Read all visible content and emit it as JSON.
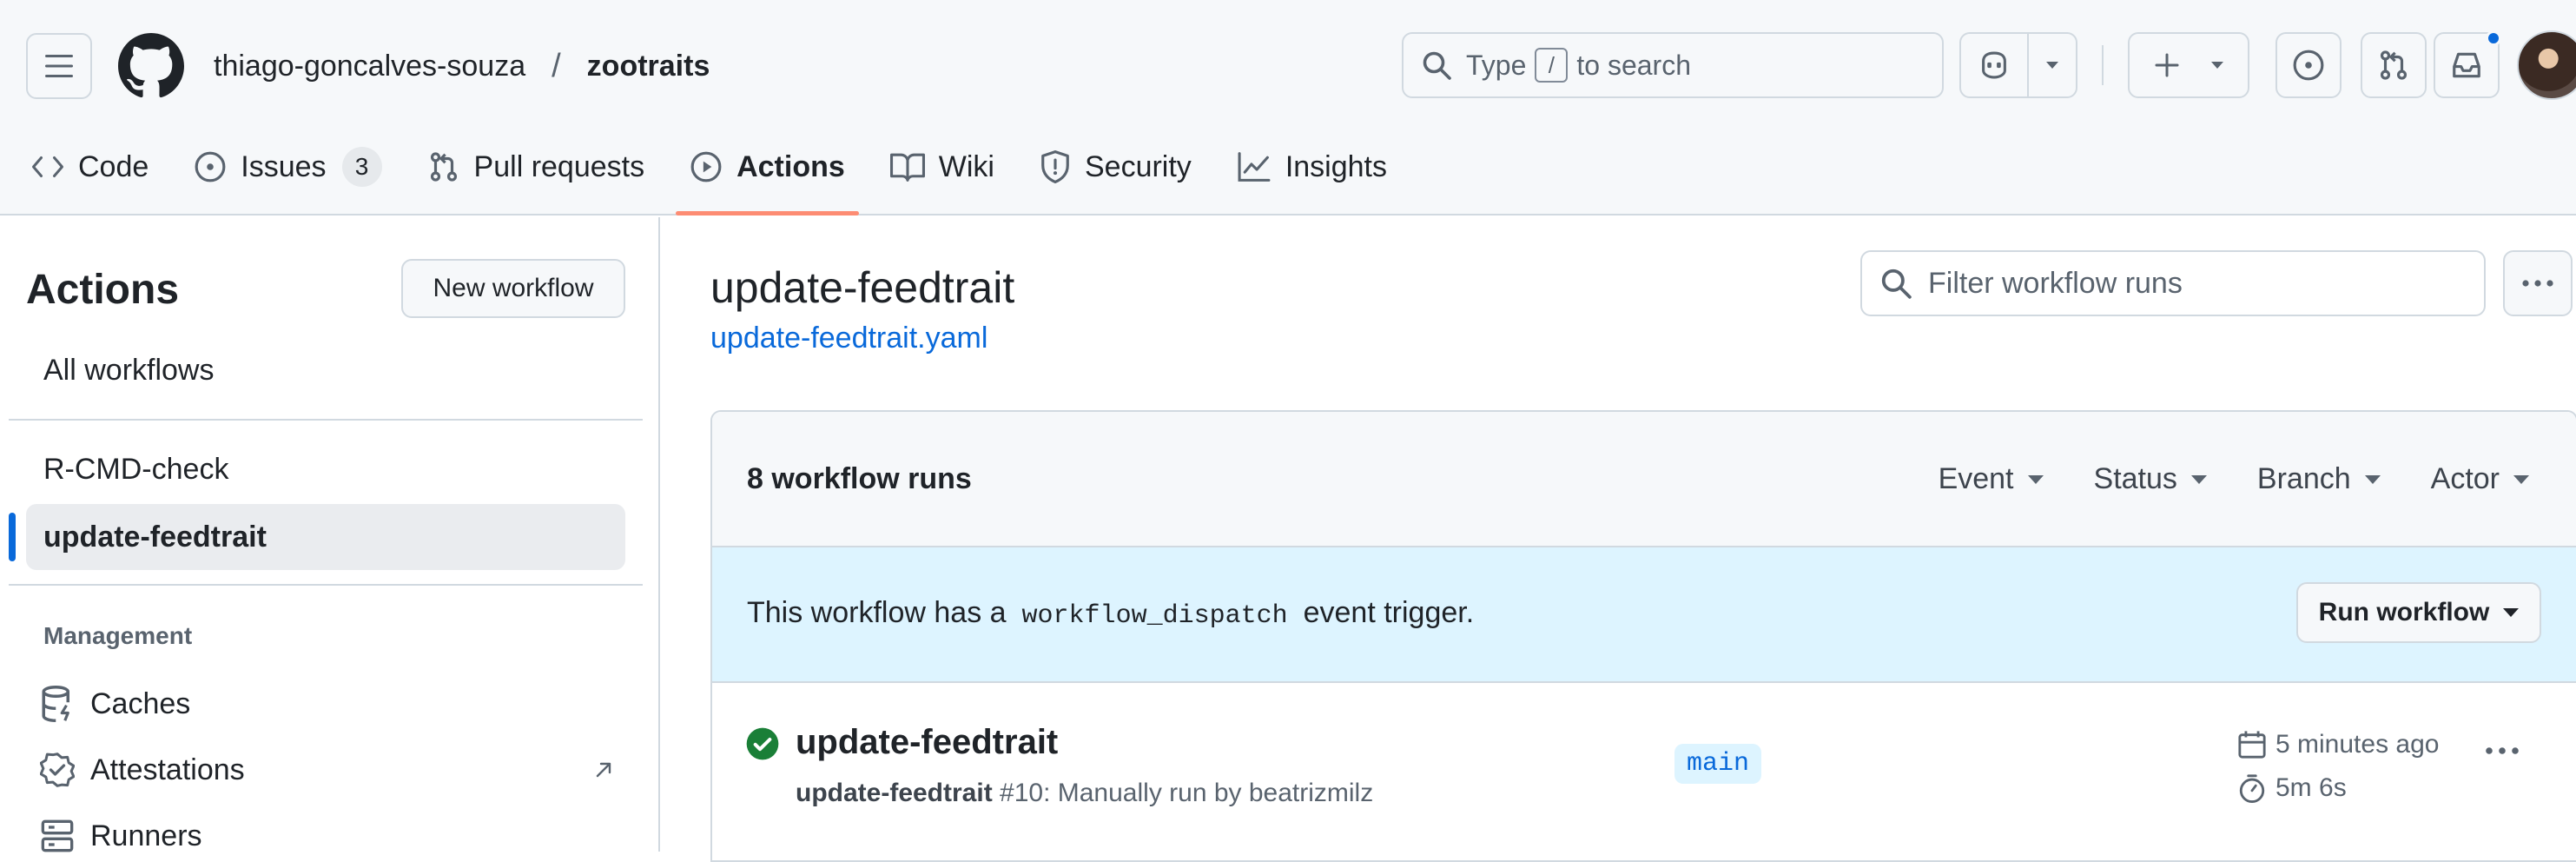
{
  "header": {
    "owner": "thiago-goncalves-souza",
    "separator": "/",
    "repo": "zootraits",
    "search": {
      "prefix": "Type",
      "key": "/",
      "suffix": "to search"
    }
  },
  "tabs": [
    {
      "label": "Code",
      "icon": "code-icon"
    },
    {
      "label": "Issues",
      "icon": "issue-opened-icon",
      "count": "3"
    },
    {
      "label": "Pull requests",
      "icon": "git-pull-request-icon"
    },
    {
      "label": "Actions",
      "icon": "play-icon",
      "active": true
    },
    {
      "label": "Wiki",
      "icon": "book-icon"
    },
    {
      "label": "Security",
      "icon": "shield-icon"
    },
    {
      "label": "Insights",
      "icon": "graph-icon"
    }
  ],
  "sidebar": {
    "title": "Actions",
    "new_workflow": "New workflow",
    "all_workflows": "All workflows",
    "workflows": [
      "R-CMD-check",
      "update-feedtrait"
    ],
    "management_heading": "Management",
    "management": [
      {
        "label": "Caches",
        "icon": "database-icon"
      },
      {
        "label": "Attestations",
        "icon": "verified-icon"
      },
      {
        "label": "Runners",
        "icon": "server-icon"
      }
    ]
  },
  "main": {
    "workflow_title": "update-feedtrait",
    "workflow_file": "update-feedtrait.yaml",
    "filter_placeholder": "Filter workflow runs",
    "runs_count": "8 workflow runs",
    "filters": [
      "Event",
      "Status",
      "Branch",
      "Actor"
    ],
    "dispatch": {
      "before": "This workflow has a",
      "code": "workflow_dispatch",
      "after": "event trigger.",
      "button": "Run workflow"
    },
    "runs": [
      {
        "title": "update-feedtrait",
        "workflow": "update-feedtrait",
        "detail": "#10: Manually run by beatrizmilz",
        "branch": "main",
        "time": "5 minutes ago",
        "duration": "5m 6s",
        "status": "success"
      }
    ]
  },
  "colors": {
    "accent": "#0969da",
    "active_tab_underline": "#fd8c73",
    "success": "#1a7f37",
    "dispatch_bg": "#ddf4ff"
  }
}
